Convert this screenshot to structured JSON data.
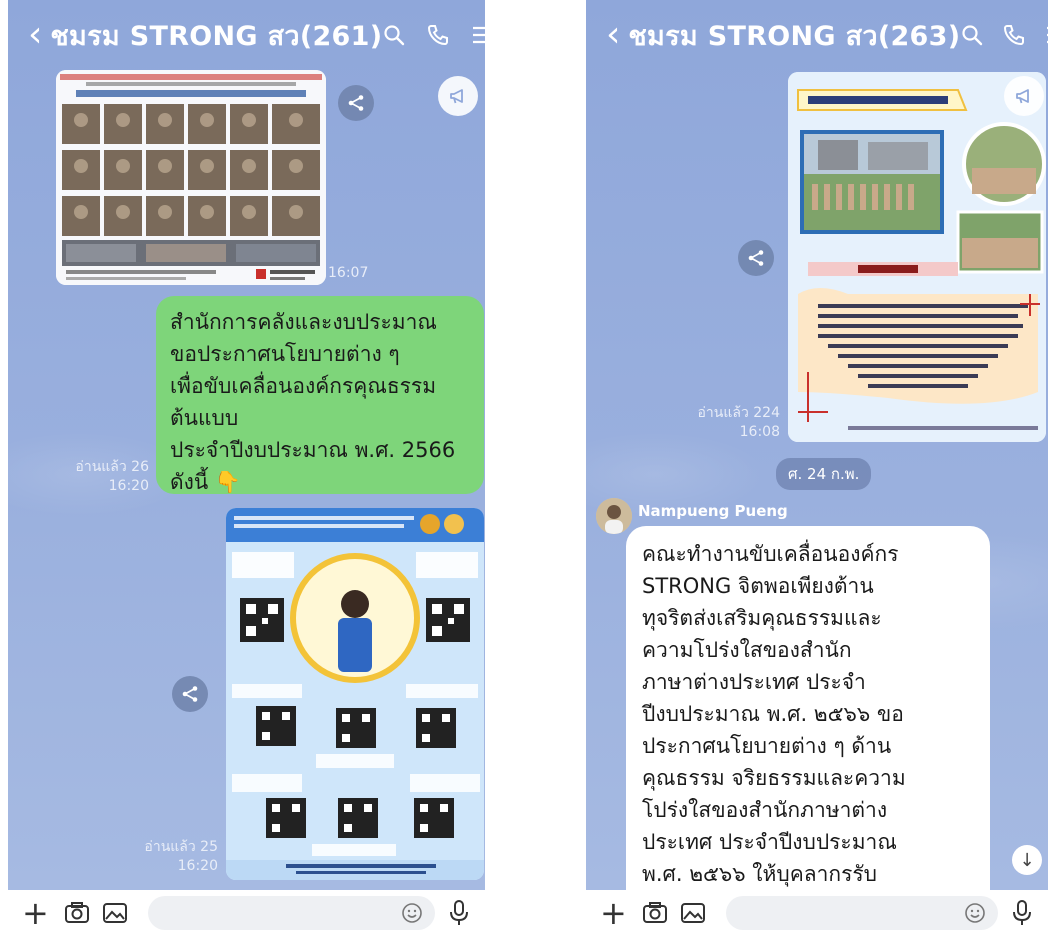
{
  "left": {
    "header": {
      "title": "ชมรม STRONG สว(261)"
    },
    "photo_card": {
      "time": "16:07"
    },
    "text_message": {
      "body": "สำนักการคลังและงบประมาณ\nขอประกาศนโยบายต่าง ๆ\nเพื่อขับเคลื่อนองค์กรคุณธรรม\nต้นแบบ\nประจำปีงบประมาณ พ.ศ. 2566\nดังนี้ 👇",
      "read": "อ่านแล้ว 26",
      "time": "16:20"
    },
    "poster_card": {
      "read": "อ่านแล้ว 25",
      "time": "16:20"
    }
  },
  "right": {
    "header": {
      "title": "ชมรม STRONG สว(263)"
    },
    "poster_card": {
      "read": "อ่านแล้ว 224",
      "time": "16:08"
    },
    "date_divider": "ศ. 24 ก.พ.",
    "incoming": {
      "sender": "Nampueng Pueng",
      "body": "คณะทำงานขับเคลื่อนองค์กร\nSTRONG จิตพอเพียงต้าน\nทุจริตส่งเสริมคุณธรรมและ\nความโปร่งใสของสำนัก\nภาษาต่างประเทศ ประจำ\nปีงบประมาณ พ.ศ. ๒๕๖๖ ขอ\nประกาศนโยบายต่าง ๆ ด้าน\nคุณธรรม จริยธรรมและความ\nโปร่งใสของสำนักภาษาต่าง\nประเทศ ประจำปีงบประมาณ\nพ.ศ. ๒๕๖๖ ให้บุคลากรรับ\nทราบโดยทั่วกัน"
    }
  },
  "icons": {
    "back": "chevron-left-icon",
    "search": "search-icon",
    "call": "phone-icon",
    "menu": "hamburger-menu-icon",
    "share": "share-icon",
    "announce": "megaphone-icon",
    "plus": "plus-icon",
    "camera": "camera-icon",
    "gallery": "image-icon",
    "emoji": "emoji-icon",
    "mic": "microphone-icon",
    "scroll": "arrow-down-icon"
  },
  "colors": {
    "chat_background": "#9ab0de",
    "outgoing_bubble": "#7ed57a",
    "incoming_bubble": "#ffffff"
  }
}
